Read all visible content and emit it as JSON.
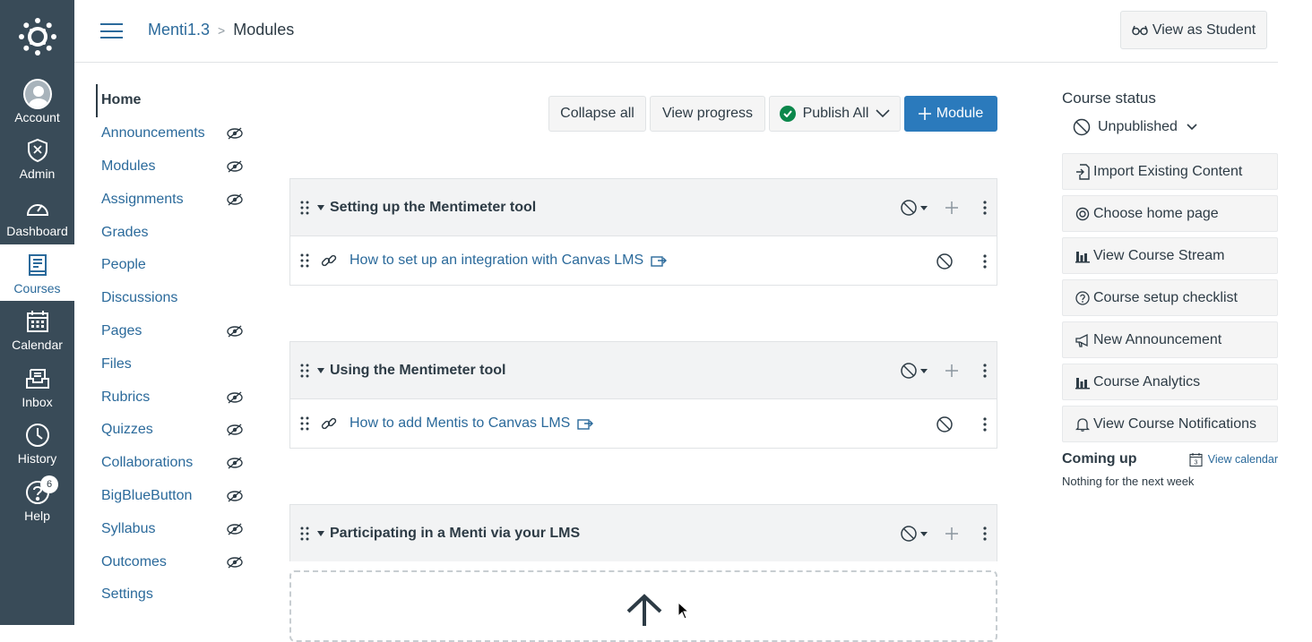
{
  "global_nav": {
    "items": [
      {
        "label": "Account",
        "icon": "avatar-icon"
      },
      {
        "label": "Admin",
        "icon": "shield-icon"
      },
      {
        "label": "Dashboard",
        "icon": "speedometer-icon"
      },
      {
        "label": "Courses",
        "icon": "book-icon",
        "active": true
      },
      {
        "label": "Calendar",
        "icon": "calendar-icon"
      },
      {
        "label": "Inbox",
        "icon": "inbox-icon"
      },
      {
        "label": "History",
        "icon": "clock-icon"
      },
      {
        "label": "Help",
        "icon": "question-icon",
        "badge": "6"
      }
    ]
  },
  "header": {
    "course": "Menti1.3",
    "page": "Modules",
    "separator": ">",
    "view_as_student": "View as Student"
  },
  "course_nav": {
    "items": [
      {
        "label": "Home",
        "active": true,
        "hidden": false
      },
      {
        "label": "Announcements",
        "hidden": true
      },
      {
        "label": "Modules",
        "hidden": true
      },
      {
        "label": "Assignments",
        "hidden": true
      },
      {
        "label": "Grades",
        "hidden": false
      },
      {
        "label": "People",
        "hidden": false
      },
      {
        "label": "Discussions",
        "hidden": false
      },
      {
        "label": "Pages",
        "hidden": true
      },
      {
        "label": "Files",
        "hidden": false
      },
      {
        "label": "Rubrics",
        "hidden": true
      },
      {
        "label": "Quizzes",
        "hidden": true
      },
      {
        "label": "Collaborations",
        "hidden": true
      },
      {
        "label": "BigBlueButton",
        "hidden": true
      },
      {
        "label": "Syllabus",
        "hidden": true
      },
      {
        "label": "Outcomes",
        "hidden": true
      },
      {
        "label": "Settings",
        "hidden": false
      }
    ]
  },
  "toolbar": {
    "collapse_all": "Collapse all",
    "view_progress": "View progress",
    "publish_all": "Publish All",
    "add_module": "Module"
  },
  "modules": [
    {
      "title": "Setting up the Mentimeter tool",
      "items": [
        {
          "label": "How to set up an integration with Canvas LMS"
        }
      ]
    },
    {
      "title": "Using the Mentimeter tool",
      "items": [
        {
          "label": "How to add Mentis to Canvas LMS"
        }
      ]
    },
    {
      "title": "Participating in a Menti via your LMS",
      "items": []
    }
  ],
  "sidebar": {
    "course_status": "Course status",
    "status_value": "Unpublished",
    "buttons": [
      {
        "label": "Import Existing Content",
        "icon": "import-icon"
      },
      {
        "label": "Choose home page",
        "icon": "target-icon"
      },
      {
        "label": "View Course Stream",
        "icon": "bar-chart-icon"
      },
      {
        "label": "Course setup checklist",
        "icon": "question-circle-icon"
      },
      {
        "label": "New Announcement",
        "icon": "megaphone-icon"
      },
      {
        "label": "Course Analytics",
        "icon": "bar-chart-icon"
      },
      {
        "label": "View Course Notifications",
        "icon": "bell-icon"
      }
    ],
    "coming_up": "Coming up",
    "view_calendar": "View calendar",
    "calendar_day": "3",
    "nothing": "Nothing for the next week"
  },
  "colors": {
    "global_nav_bg": "#394b58",
    "link": "#2b6a9b",
    "primary": "#2b7abc",
    "published_green": "#0b874b"
  }
}
